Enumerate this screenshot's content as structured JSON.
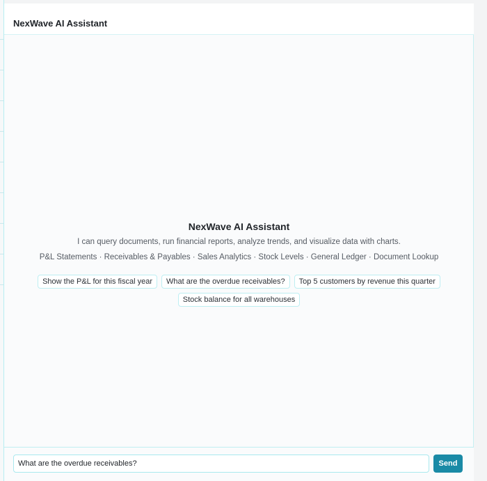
{
  "header": {
    "title": "NexWave AI Assistant"
  },
  "welcome": {
    "title": "NexWave AI Assistant",
    "subtitle": "I can query documents, run financial reports, analyze trends, and visualize data with charts.",
    "capabilities": "P&L Statements · Receivables & Payables · Sales Analytics · Stock Levels · General Ledger · Document Lookup"
  },
  "suggestions": [
    "Show the P&L for this fiscal year",
    "What are the overdue receivables?",
    "Top 5 customers by revenue this quarter",
    "Stock balance for all warehouses"
  ],
  "composer": {
    "input_value": "What are the overdue receivables?",
    "send_label": "Send"
  },
  "colors": {
    "accent": "#1a8aa6",
    "border": "#bdeef2"
  }
}
